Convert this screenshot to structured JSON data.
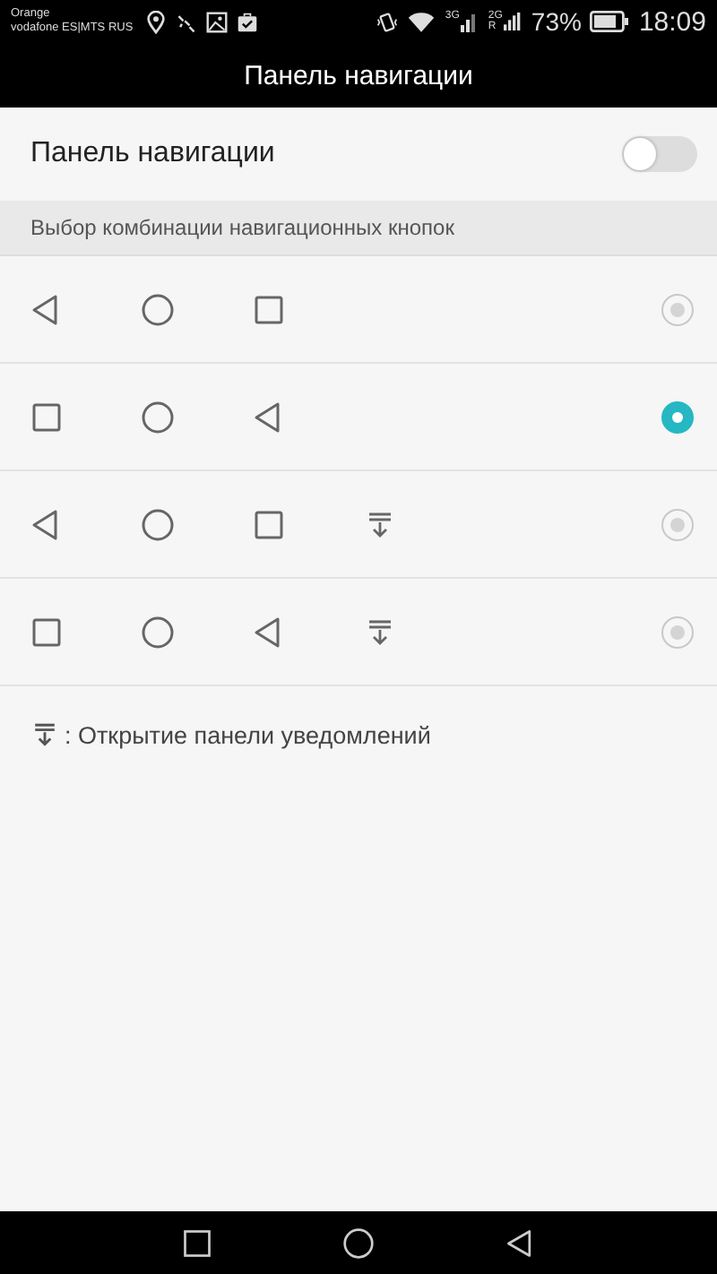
{
  "status_bar": {
    "carrier_1": "Orange",
    "carrier_2": "vodafone ES|MTS RUS",
    "network_1": "3G",
    "network_2": "2G",
    "roaming": "R",
    "battery": "73%",
    "time": "18:09"
  },
  "title": "Панель навигации",
  "toggle": {
    "label": "Панель навигации",
    "on": false
  },
  "section_header": "Выбор комбинации навигационных кнопок",
  "combinations": [
    {
      "buttons": [
        {
          "kind": "back"
        },
        {
          "kind": "home"
        },
        {
          "kind": "recent"
        }
      ],
      "selected": false
    },
    {
      "buttons": [
        {
          "kind": "recent"
        },
        {
          "kind": "home"
        },
        {
          "kind": "back"
        }
      ],
      "selected": true
    },
    {
      "buttons": [
        {
          "kind": "back"
        },
        {
          "kind": "home"
        },
        {
          "kind": "recent"
        },
        {
          "kind": "notification"
        }
      ],
      "selected": false
    },
    {
      "buttons": [
        {
          "kind": "recent"
        },
        {
          "kind": "home"
        },
        {
          "kind": "back"
        },
        {
          "kind": "notification"
        }
      ],
      "selected": false
    }
  ],
  "note": ": Открытие панели уведомлений",
  "nav_bar": [
    {
      "kind": "recent"
    },
    {
      "kind": "home"
    },
    {
      "kind": "back"
    }
  ]
}
